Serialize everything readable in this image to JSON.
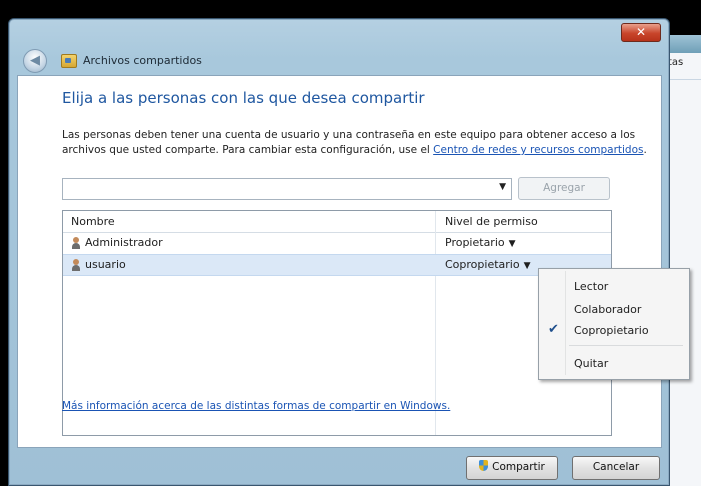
{
  "background_window": {
    "tab_label": "tas"
  },
  "dialog": {
    "title": "Archivos compartidos",
    "close_label": "✕",
    "heading": "Elija a las personas con las que desea compartir",
    "description_prefix": "Las personas deben tener una cuenta de usuario y una contraseña en este equipo para obtener acceso a los archivos que usted comparte. Para cambiar esta configuración, use el ",
    "description_link": "Centro de redes y recursos compartidos",
    "description_suffix": ".",
    "combo_value": "",
    "add_button": "Agregar",
    "list": {
      "columns": [
        "Nombre",
        "Nivel de permiso"
      ],
      "rows": [
        {
          "name": "Administrador",
          "permission": "Propietario"
        },
        {
          "name": "usuario",
          "permission": "Copropietario"
        }
      ]
    },
    "more_info_link": "Más información acerca de las distintas formas de compartir en Windows.",
    "share_button": "Compartir",
    "cancel_button": "Cancelar"
  },
  "context_menu": {
    "items": [
      {
        "label": "Lector",
        "checked": false
      },
      {
        "label": "Colaborador",
        "checked": false
      },
      {
        "label": "Copropietario",
        "checked": true
      },
      {
        "label": "Quitar",
        "checked": false
      }
    ]
  },
  "colors": {
    "link": "#1a54b4",
    "heading": "#1f57a0",
    "selection": "#dbe8f7"
  }
}
